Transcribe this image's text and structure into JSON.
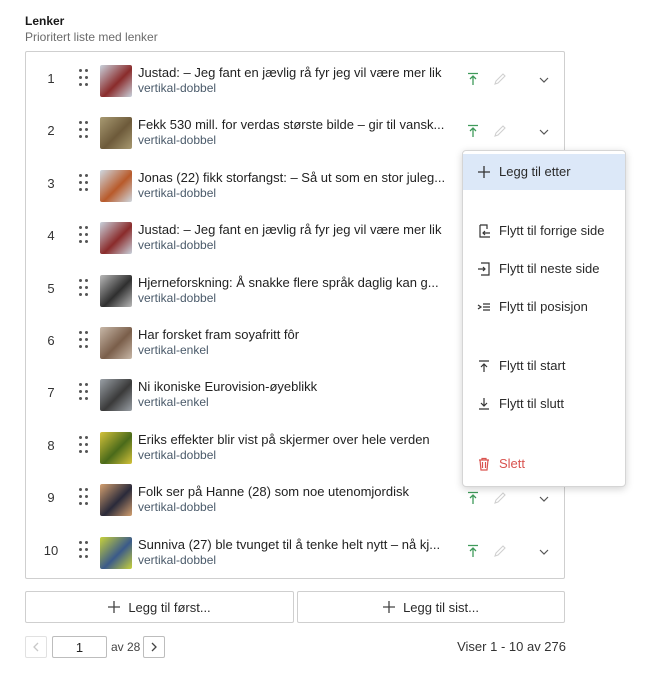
{
  "header": {
    "title": "Lenker",
    "subtitle": "Prioritert liste med lenker"
  },
  "rows": [
    {
      "num": "1",
      "title": "Justad: – Jeg fant en jævlig rå fyr jeg vil være mer lik",
      "type": "vertikal-dobbel",
      "thumb": [
        "#8a2b2b",
        "#c9d2dc"
      ]
    },
    {
      "num": "2",
      "title": "Fekk 530 mill. for verdas største bilde – gir til vansk...",
      "type": "vertikal-dobbel",
      "thumb": [
        "#6d5a3a",
        "#a89a72"
      ]
    },
    {
      "num": "3",
      "title": "Jonas (22) fikk storfangst: – Så ut som en stor juleg...",
      "type": "vertikal-dobbel",
      "thumb": [
        "#b85a2a",
        "#cfd8e0"
      ]
    },
    {
      "num": "4",
      "title": "Justad: – Jeg fant en jævlig rå fyr jeg vil være mer lik",
      "type": "vertikal-dobbel",
      "thumb": [
        "#8a2b2b",
        "#c9d2dc"
      ]
    },
    {
      "num": "5",
      "title": "Hjerneforskning: Å snakke flere språk daglig kan g...",
      "type": "vertikal-dobbel",
      "thumb": [
        "#2f2f2f",
        "#b9b9b9"
      ]
    },
    {
      "num": "6",
      "title": "Har forsket fram soyafritt fôr",
      "type": "vertikal-enkel",
      "thumb": [
        "#7a5e4a",
        "#c8b8a8"
      ]
    },
    {
      "num": "7",
      "title": "Ni ikoniske Eurovision-øyeblikk",
      "type": "vertikal-enkel",
      "thumb": [
        "#3a3a3a",
        "#9aa0a6"
      ]
    },
    {
      "num": "8",
      "title": "Eriks effekter blir vist på skjermer over hele verden",
      "type": "vertikal-dobbel",
      "thumb": [
        "#4a6a1a",
        "#d4c23a"
      ]
    },
    {
      "num": "9",
      "title": "Folk ser på Hanne (28) som noe utenomjordisk",
      "type": "vertikal-dobbel",
      "thumb": [
        "#2a2a3a",
        "#d4a070"
      ]
    },
    {
      "num": "10",
      "title": "Sunniva (27) ble tvunget til å tenke helt nytt – nå kj...",
      "type": "vertikal-dobbel",
      "thumb": [
        "#3a5a8a",
        "#c8d23a"
      ]
    }
  ],
  "menu": {
    "add_after": "Legg til etter",
    "move_prev_page": "Flytt til forrige side",
    "move_next_page": "Flytt til neste side",
    "move_position": "Flytt til posisjon",
    "move_start": "Flytt til start",
    "move_end": "Flytt til slutt",
    "delete": "Slett"
  },
  "buttons": {
    "add_first": "Legg til først...",
    "add_last": "Legg til sist..."
  },
  "pager": {
    "page": "1",
    "of": "av 28",
    "showing": "Viser 1 - 10 av 276"
  },
  "colors": {
    "accent_green": "#3f9a5a",
    "menu_active": "#dce8f8",
    "danger": "#d9534f"
  }
}
